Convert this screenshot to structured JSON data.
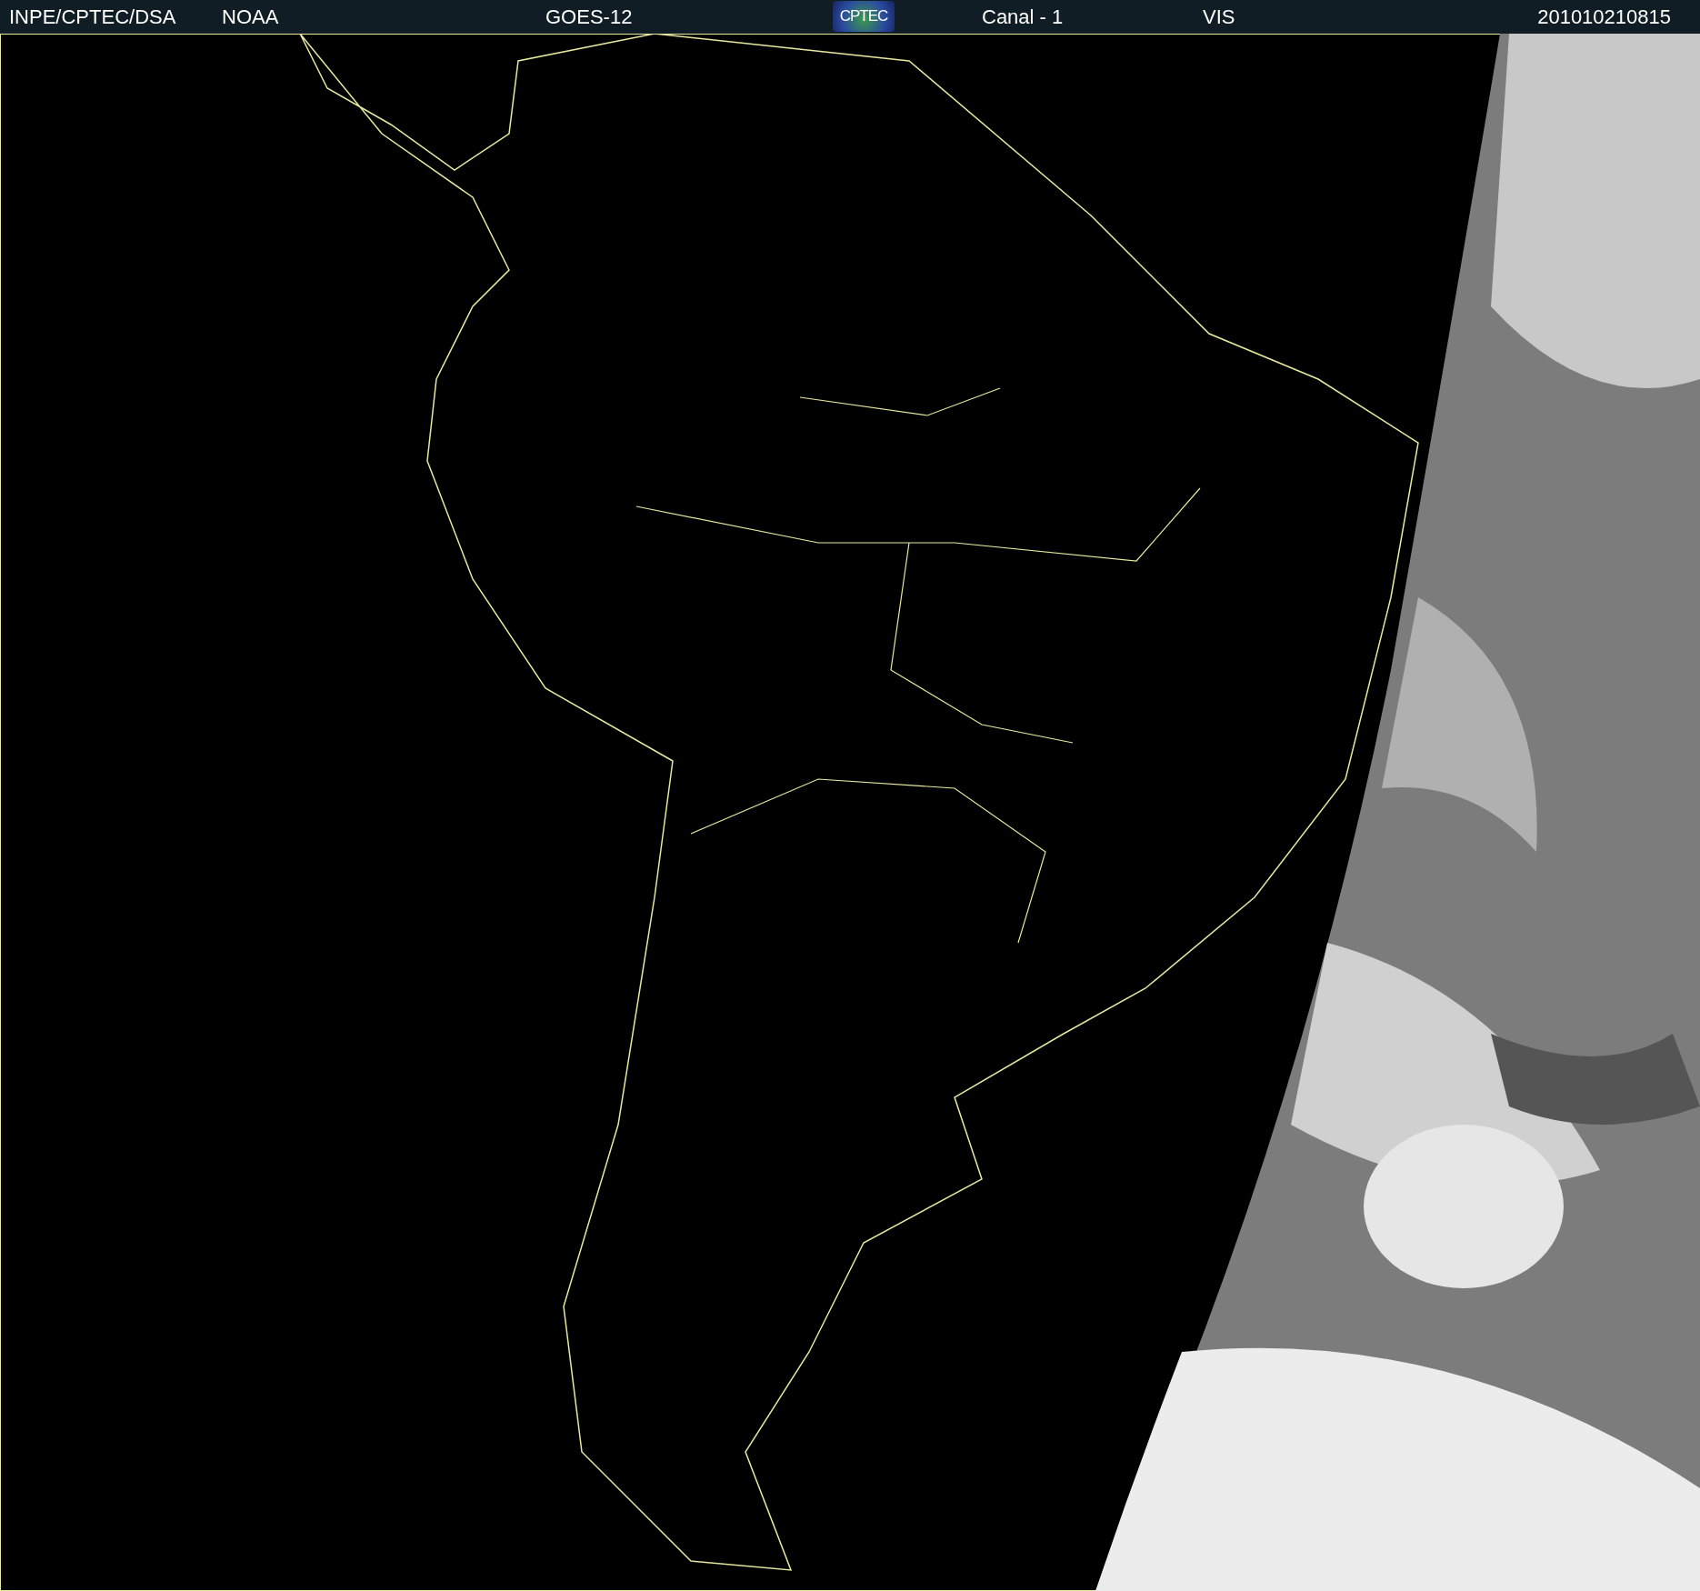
{
  "header": {
    "institution": "INPE/CPTEC/DSA",
    "agency": "NOAA",
    "satellite": "GOES-12",
    "logo": "CPTEC",
    "channel": "Canal - 1",
    "band": "VIS",
    "timestamp": "201010210815"
  }
}
